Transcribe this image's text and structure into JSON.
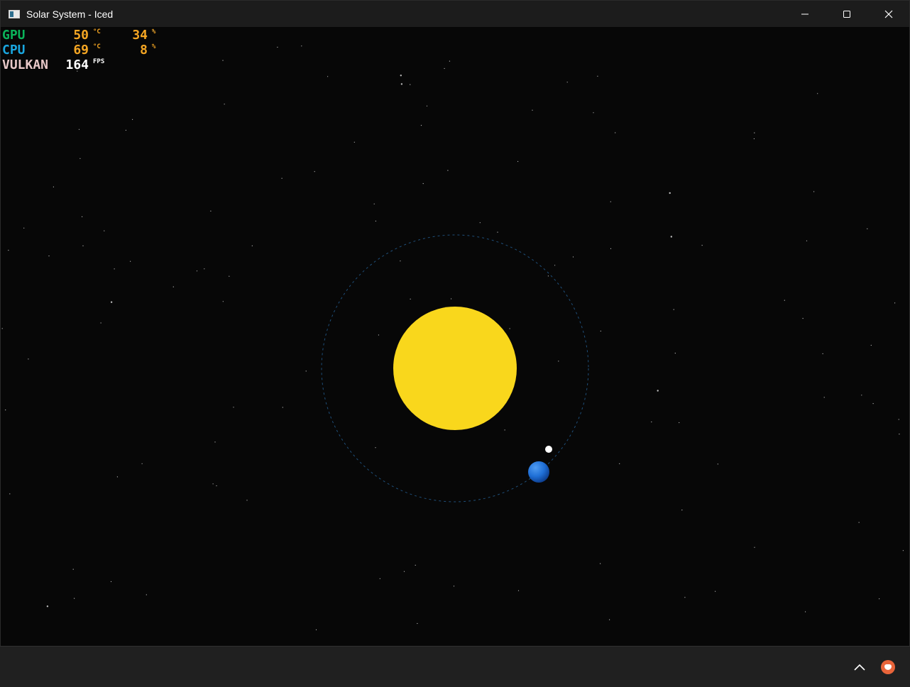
{
  "window": {
    "title": "Solar System - Iced",
    "controls": {
      "minimize": "—",
      "maximize": "☐",
      "close": "✕"
    }
  },
  "hud": {
    "rows": [
      {
        "label": "GPU",
        "value1": "50",
        "unit1": "°C",
        "value2": "34",
        "unit2": "%",
        "label_color": "#0bb35a",
        "value_color": "#f5a623"
      },
      {
        "label": "CPU",
        "value1": "69",
        "unit1": "°C",
        "value2": "8",
        "unit2": "%",
        "label_color": "#1aa7e0",
        "value_color": "#f5a623"
      },
      {
        "label": "VULKAN",
        "value1": "164",
        "unit1": "FPS",
        "label_color": "#e8c8c8",
        "value_color": "#ffffff"
      }
    ]
  },
  "scene": {
    "sun_color": "#f9d71c",
    "earth_color": "#1f6fd6",
    "moon_color": "#ffffff",
    "orbit_color": "#1f4f7a",
    "background_color": "#070707"
  },
  "taskbar": {
    "tray_chevron": "^",
    "tray_app_icon": "cat-icon"
  }
}
